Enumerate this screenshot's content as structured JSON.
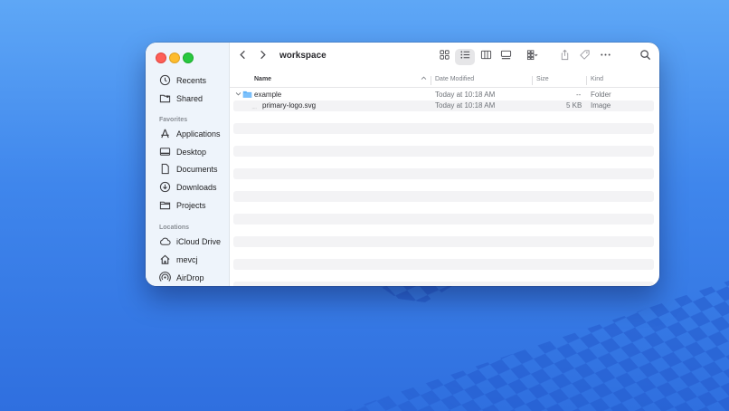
{
  "window": {
    "title": "workspace"
  },
  "sidebar": {
    "top_items": [
      {
        "label": "Recents",
        "icon": "clock-icon"
      },
      {
        "label": "Shared",
        "icon": "shared-folder-icon"
      }
    ],
    "favorites_heading": "Favorites",
    "favorites": [
      {
        "label": "Applications",
        "icon": "applications-icon"
      },
      {
        "label": "Desktop",
        "icon": "desktop-icon"
      },
      {
        "label": "Documents",
        "icon": "document-icon"
      },
      {
        "label": "Downloads",
        "icon": "download-icon"
      },
      {
        "label": "Projects",
        "icon": "folder-icon"
      }
    ],
    "locations_heading": "Locations",
    "locations": [
      {
        "label": "iCloud Drive",
        "icon": "cloud-icon"
      },
      {
        "label": "mevcj",
        "icon": "home-icon"
      },
      {
        "label": "AirDrop",
        "icon": "airdrop-icon"
      }
    ]
  },
  "columns": {
    "name": "Name",
    "date": "Date Modified",
    "size": "Size",
    "kind": "Kind"
  },
  "files": [
    {
      "name": "example",
      "date": "Today at 10:18 AM",
      "size": "--",
      "kind": "Folder"
    },
    {
      "name": "primary-logo.svg",
      "date": "Today at 10:18 AM",
      "size": "5 KB",
      "kind": "Image"
    }
  ],
  "colors": {
    "accent": "#3b8ff0",
    "folder": "#5aaef7",
    "desktop": "#3f86ec"
  }
}
